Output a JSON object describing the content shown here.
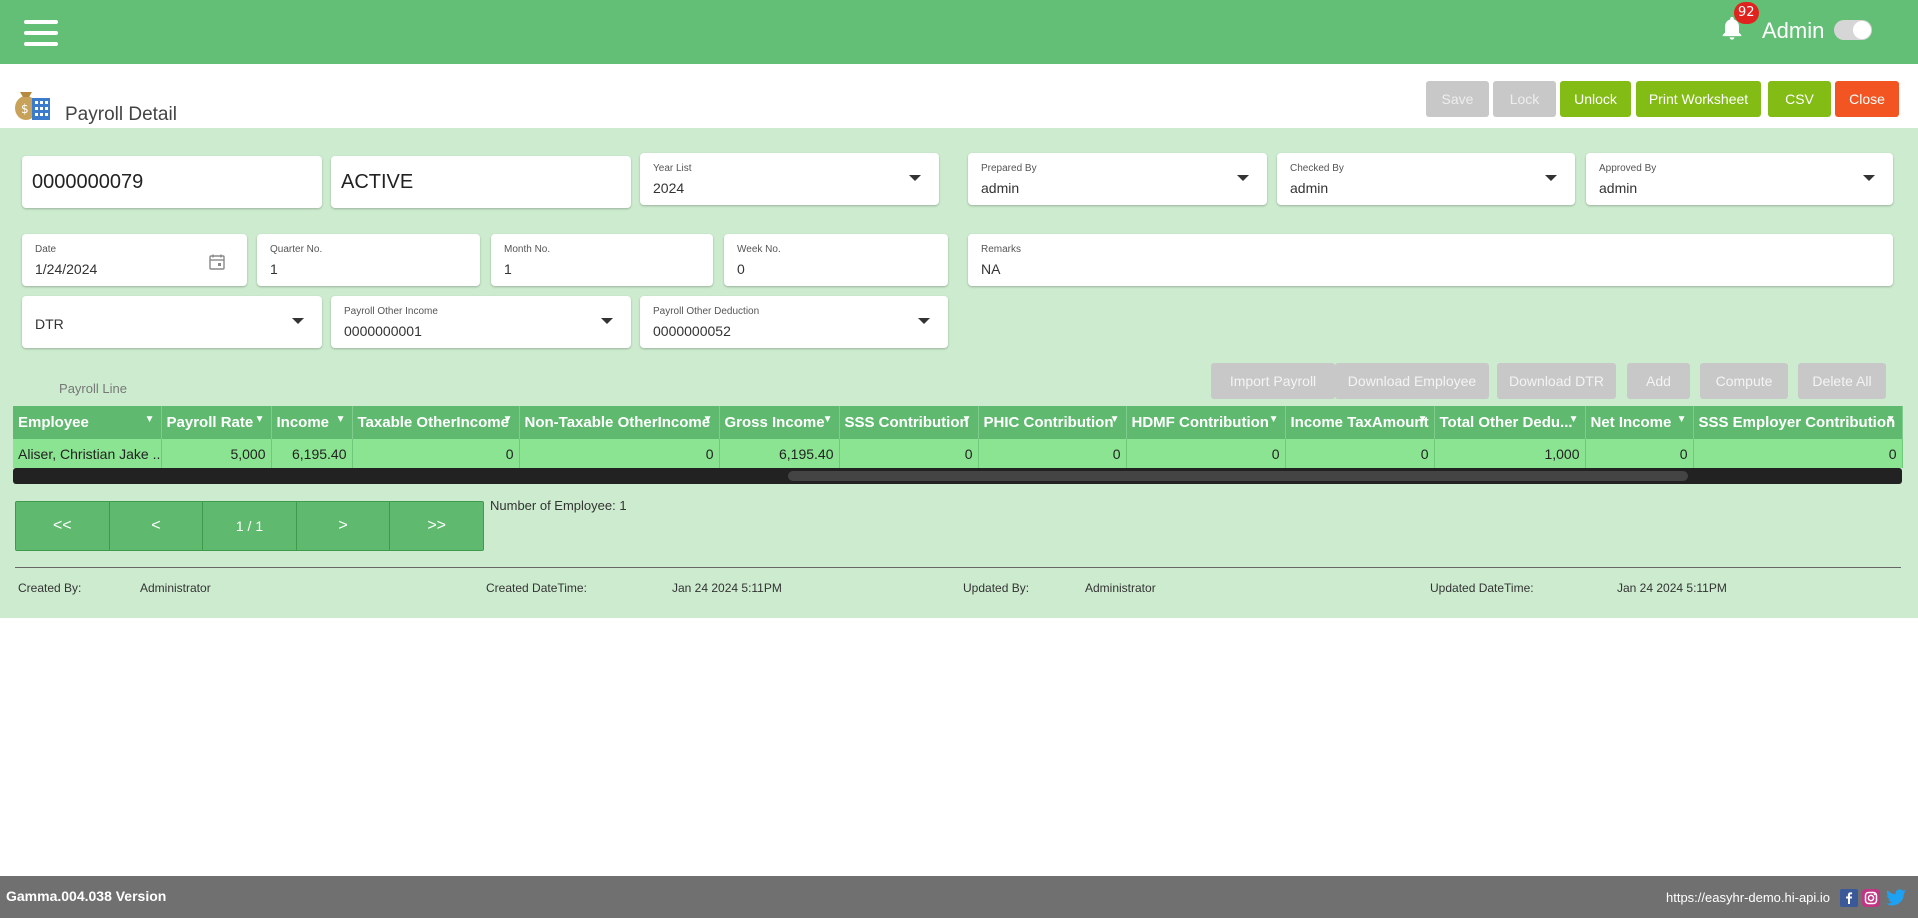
{
  "topbar": {
    "notification_count": "92",
    "user_name": "Admin"
  },
  "page": {
    "title": "Payroll Detail"
  },
  "header_buttons": {
    "save": "Save",
    "lock": "Lock",
    "unlock": "Unlock",
    "print_worksheet": "Print Worksheet",
    "csv": "CSV",
    "close": "Close"
  },
  "form": {
    "payroll_no": "0000000079",
    "status": "ACTIVE",
    "year_list": {
      "label": "Year List",
      "value": "2024"
    },
    "prepared_by": {
      "label": "Prepared By",
      "value": "admin"
    },
    "checked_by": {
      "label": "Checked By",
      "value": "admin"
    },
    "approved_by": {
      "label": "Approved By",
      "value": "admin"
    },
    "date": {
      "label": "Date",
      "value": "1/24/2024"
    },
    "quarter_no": {
      "label": "Quarter No.",
      "value": "1"
    },
    "month_no": {
      "label": "Month No.",
      "value": "1"
    },
    "week_no": {
      "label": "Week No.",
      "value": "0"
    },
    "remarks": {
      "label": "Remarks",
      "value": "NA"
    },
    "payroll_type": {
      "value": "DTR"
    },
    "payroll_other_income": {
      "label": "Payroll Other Income",
      "value": "0000000001"
    },
    "payroll_other_deduction": {
      "label": "Payroll Other Deduction",
      "value": "0000000052"
    }
  },
  "tab": {
    "label": "Payroll Line"
  },
  "actions": {
    "import_payroll": "Import Payroll",
    "download_employee": "Download Employee",
    "download_dtr": "Download DTR",
    "add": "Add",
    "compute": "Compute",
    "delete_all": "Delete All"
  },
  "grid": {
    "columns": [
      "Employee",
      "Payroll Rate",
      "Income",
      "Taxable OtherIncome",
      "Non-Taxable OtherIncome",
      "Gross Income",
      "SSS Contribution",
      "PHIC Contribution",
      "HDMF Contribution",
      "Income TaxAmount",
      "Total Other Dedu...",
      "Net Income",
      "SSS Employer Contribution"
    ],
    "rows": [
      [
        "Aliser, Christian Jake ...",
        "5,000",
        "6,195.40",
        "0",
        "0",
        "6,195.40",
        "0",
        "0",
        "0",
        "0",
        "1,000",
        "0",
        "0"
      ]
    ]
  },
  "pager": {
    "first": "<<",
    "prev": "<",
    "info": "1 / 1",
    "next": ">",
    "last": ">>",
    "employee_count": "Number of Employee: 1"
  },
  "meta": {
    "created_by_label": "Created By:",
    "created_by": "Administrator",
    "created_dt_label": "Created DateTime:",
    "created_dt": "Jan 24 2024 5:11PM",
    "updated_by_label": "Updated By:",
    "updated_by": "Administrator",
    "updated_dt_label": "Updated DateTime:",
    "updated_dt": "Jan 24 2024 5:11PM"
  },
  "footer": {
    "version": "Gamma.004.038 Version",
    "url": "https://easyhr-demo.hi-api.io"
  },
  "colors": {
    "topbar": "#63bf75",
    "panel": "#cdeccf",
    "grid_header": "#5fba6f",
    "grid_row": "#8be491",
    "button_green": "#82bc14",
    "button_red": "#f25522",
    "footer": "#707070"
  }
}
